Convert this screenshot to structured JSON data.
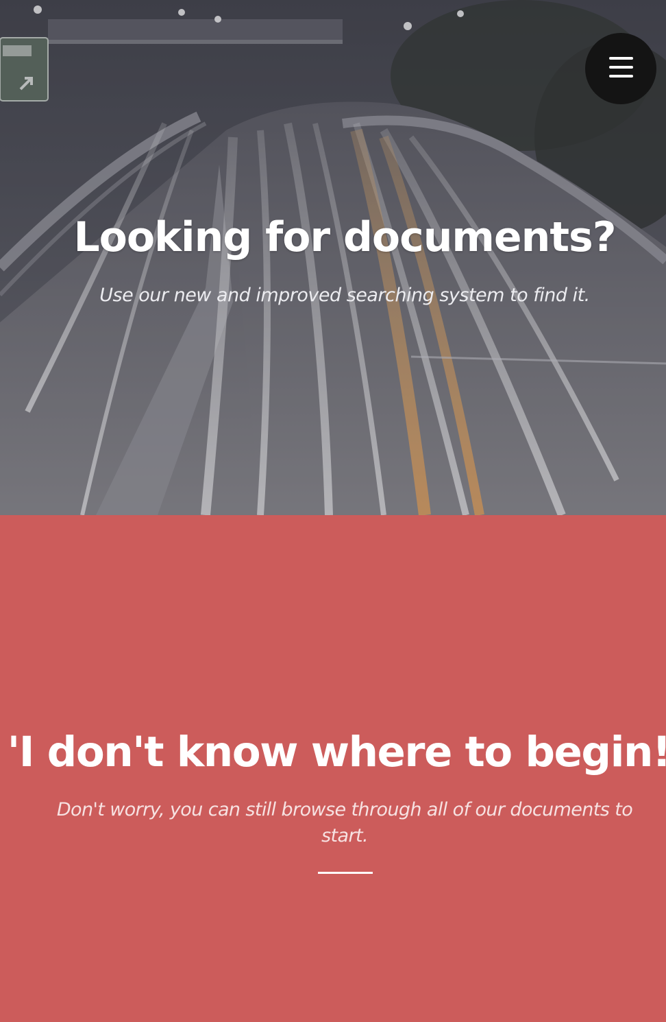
{
  "hero": {
    "title": "Looking for documents?",
    "subtitle": "Use our new and improved searching system to find it.",
    "background_icon": "night-highway-photo",
    "overlay_color": "#3d3d47"
  },
  "menu": {
    "icon": "hamburger-menu-icon",
    "background_color": "#141414"
  },
  "about": {
    "title": "'I don't know where to begin!'",
    "text": "Don't worry, you can still browse through all of our documents to start.",
    "background_color": "#cc5c5b"
  }
}
